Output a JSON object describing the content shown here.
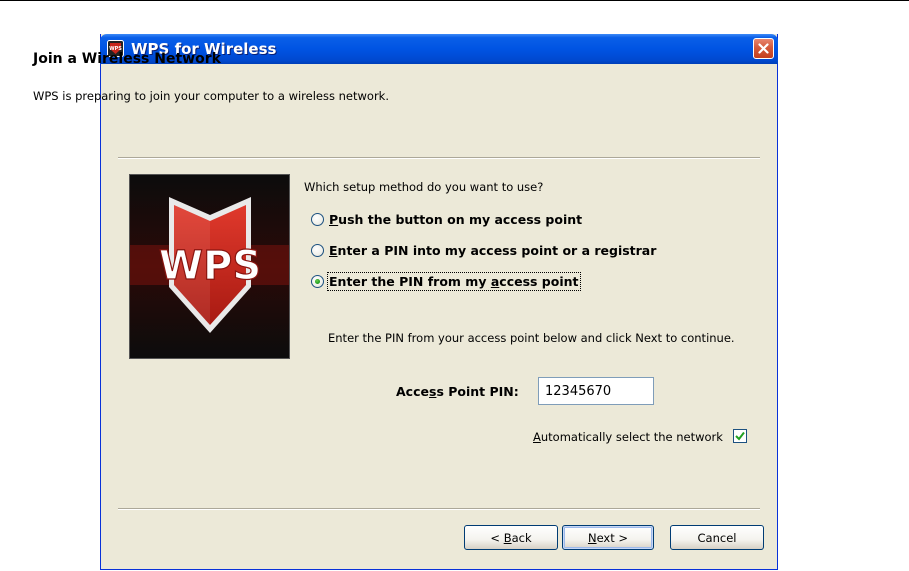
{
  "window": {
    "title": "WPS for Wireless",
    "icon": "wps-app-icon",
    "close_icon": "close-x-icon"
  },
  "header": {
    "title": "Join a Wireless Network",
    "description": "WPS is preparing to join your computer to a wireless network."
  },
  "logo": {
    "text": "WPS",
    "icon": "wps-shield-logo",
    "colors": {
      "shield": "#c8261c",
      "background": "#111111",
      "accent": "#8a1510"
    }
  },
  "setup": {
    "question": "Which setup method do you want to use?",
    "options": [
      {
        "label": "Push the button on my access point",
        "mnemonic": "P",
        "selected": false
      },
      {
        "label": "Enter a PIN into my access point or a registrar",
        "mnemonic": "E",
        "selected": false
      },
      {
        "label": "Enter the PIN from my access point",
        "mnemonic": "a",
        "selected": true
      }
    ]
  },
  "pin": {
    "instruction": "Enter the PIN from your access point below and click Next to continue.",
    "label": "Access Point PIN:",
    "value": "12345670"
  },
  "auto_select": {
    "label": "Automatically select the network",
    "checked": true
  },
  "buttons": {
    "back": "< Back",
    "next": "Next >",
    "cancel": "Cancel"
  },
  "colors": {
    "titlebar": "#0054e3",
    "dialog_bg": "#ece9d8",
    "close_button": "#d45a3b",
    "radio_dot": "#21a121",
    "check_mark": "#21a121"
  }
}
